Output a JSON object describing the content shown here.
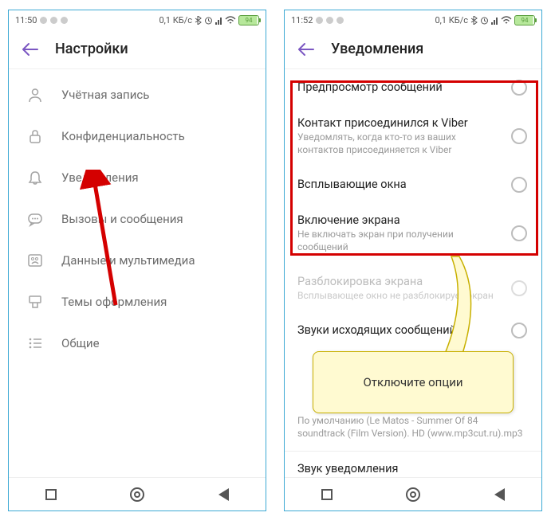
{
  "left": {
    "status": {
      "time": "11:50",
      "data": "0,1 КБ/с",
      "battery": "94"
    },
    "header": {
      "title": "Настройки"
    },
    "items": [
      {
        "label": "Учётная запись"
      },
      {
        "label": "Конфиденциальность"
      },
      {
        "label": "Уведомления"
      },
      {
        "label": "Вызовы и сообщения"
      },
      {
        "label": "Данные и мультимедиа"
      },
      {
        "label": "Темы оформления"
      },
      {
        "label": "Общие"
      }
    ]
  },
  "right": {
    "status": {
      "time": "11:52",
      "data": "0,1 КБ/с",
      "battery": "94"
    },
    "header": {
      "title": "Уведомления"
    },
    "items": [
      {
        "title": "Предпросмотр сообщений",
        "sub": ""
      },
      {
        "title": "Контакт присоединился к Viber",
        "sub": "Уведомлять, когда кто-то из ваших контактов присоединяется к Viber"
      },
      {
        "title": "Всплывающие окна",
        "sub": ""
      },
      {
        "title": "Включение экрана",
        "sub": "Не включать экран при получении сообщений"
      },
      {
        "title": "Разблокировка экрана",
        "sub": "Всплывающее окно не разблокирует экран"
      },
      {
        "title": "Звуки исходящих сообщений",
        "sub": ""
      }
    ],
    "ringtone_sub": "По умолчанию (Le Matos - Summer Of 84 soundtrack (Film Version). HD (www.mp3cut.ru).mp3",
    "bottom_item": "Звук уведомления"
  },
  "callout": "Отключите опции"
}
